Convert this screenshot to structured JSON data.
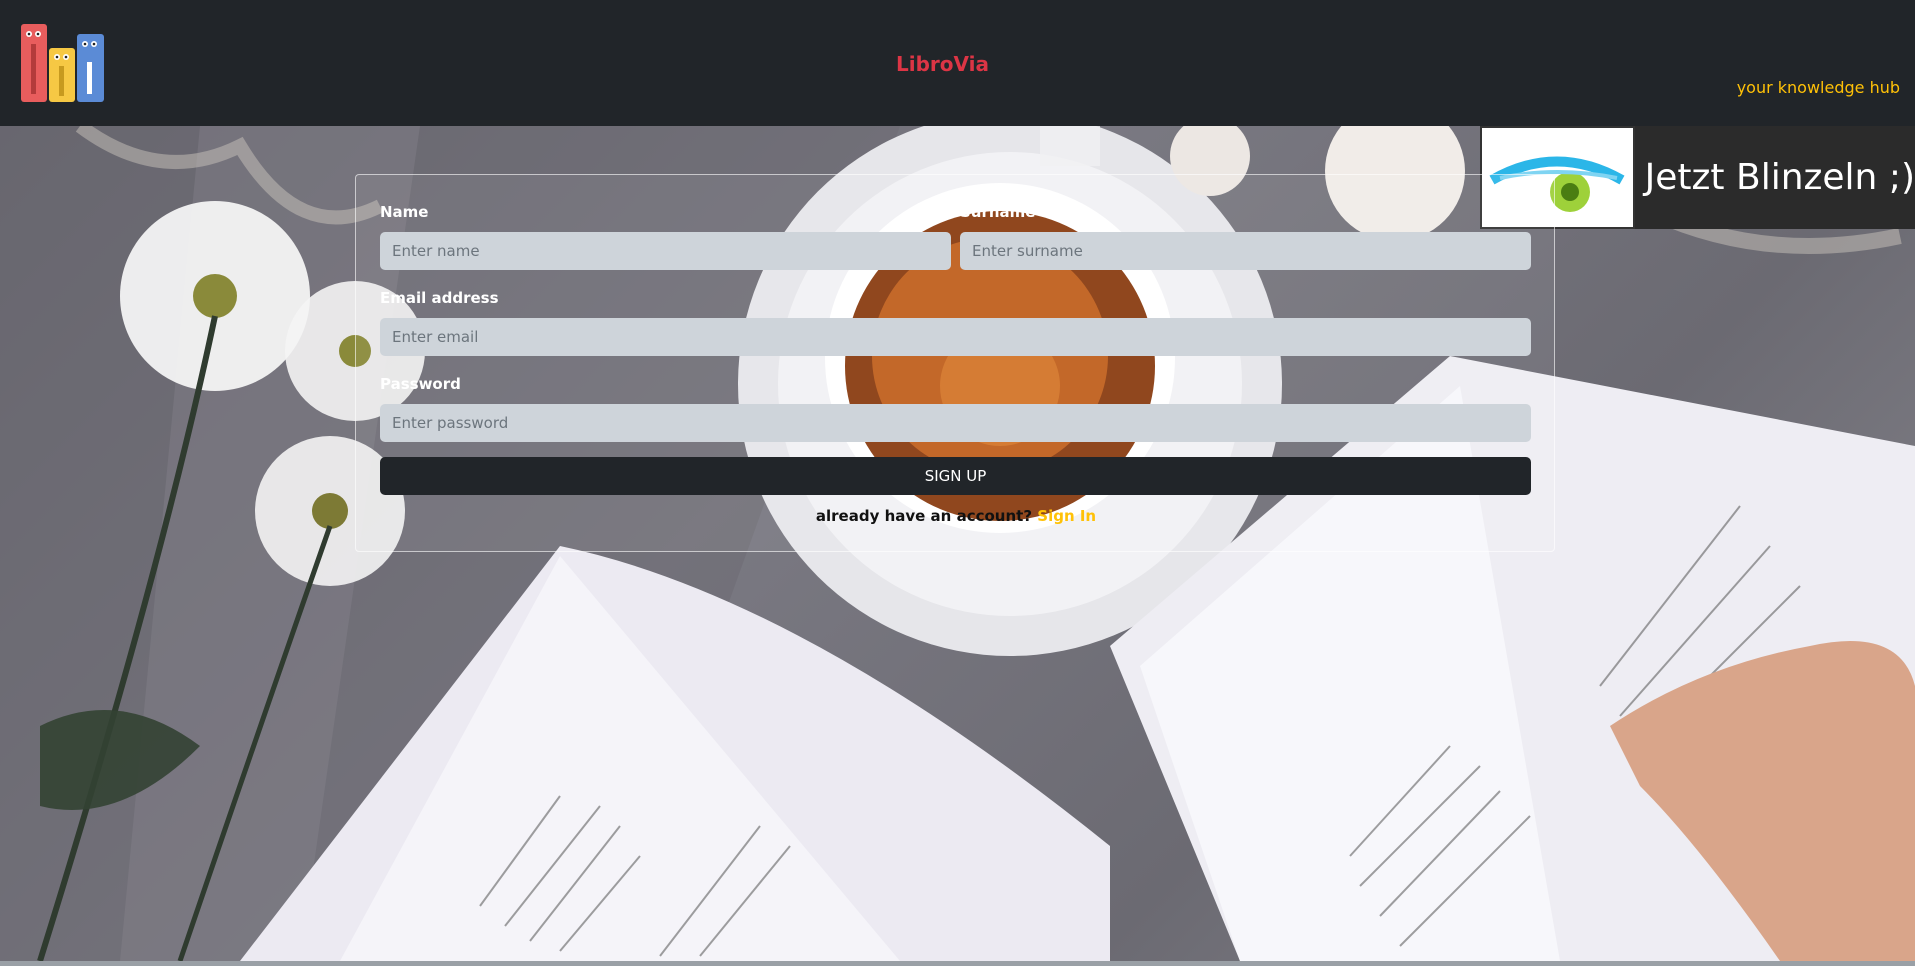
{
  "header": {
    "brand": "LibroVia",
    "tagline": "your knowledge hub"
  },
  "blink": {
    "label": "Jetzt Blinzeln ;)"
  },
  "form": {
    "name_label": "Name",
    "name_placeholder": "Enter name",
    "surname_label": "Surname",
    "surname_placeholder": "Enter surname",
    "email_label": "Email address",
    "email_placeholder": "Enter email",
    "password_label": "Password",
    "password_placeholder": "Enter password",
    "submit_label": "SIGN UP",
    "signin_prompt": "already have an account?",
    "signin_link": "Sign In"
  },
  "colors": {
    "brand": "#dc3545",
    "accent": "#ffc107",
    "dark": "#212529",
    "input_bg": "#ced4da"
  }
}
